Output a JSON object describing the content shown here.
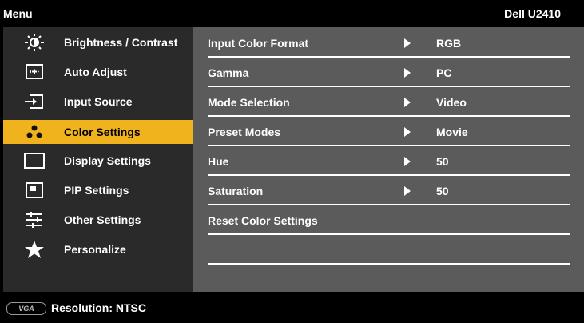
{
  "topbar": {
    "menu_label": "Menu",
    "model": "Dell U2410"
  },
  "sidebar": {
    "items": [
      {
        "label": "Brightness / Contrast",
        "icon": "brightness-icon",
        "active": false
      },
      {
        "label": "Auto Adjust",
        "icon": "auto-adjust-icon",
        "active": false
      },
      {
        "label": "Input Source",
        "icon": "input-source-icon",
        "active": false
      },
      {
        "label": "Color Settings",
        "icon": "color-settings-icon",
        "active": true
      },
      {
        "label": "Display Settings",
        "icon": "display-settings-icon",
        "active": false
      },
      {
        "label": "PIP Settings",
        "icon": "pip-settings-icon",
        "active": false
      },
      {
        "label": "Other Settings",
        "icon": "other-settings-icon",
        "active": false
      },
      {
        "label": "Personalize",
        "icon": "star-icon",
        "active": false
      }
    ]
  },
  "color_settings": {
    "rows": [
      {
        "name": "Input Color Format",
        "value": "RGB"
      },
      {
        "name": "Gamma",
        "value": "PC"
      },
      {
        "name": "Mode Selection",
        "value": "Video"
      },
      {
        "name": "Preset Modes",
        "value": "Movie"
      },
      {
        "name": "Hue",
        "value": "50"
      },
      {
        "name": "Saturation",
        "value": "50"
      },
      {
        "name": "Reset Color Settings",
        "value": ""
      },
      {
        "name": "",
        "value": ""
      }
    ]
  },
  "footer": {
    "connector": "VGA",
    "resolution": "Resolution: NTSC"
  },
  "colors": {
    "active_highlight": "#f0b21d",
    "left_panel": "#2a2a2a",
    "right_panel": "#5b5b5b"
  }
}
